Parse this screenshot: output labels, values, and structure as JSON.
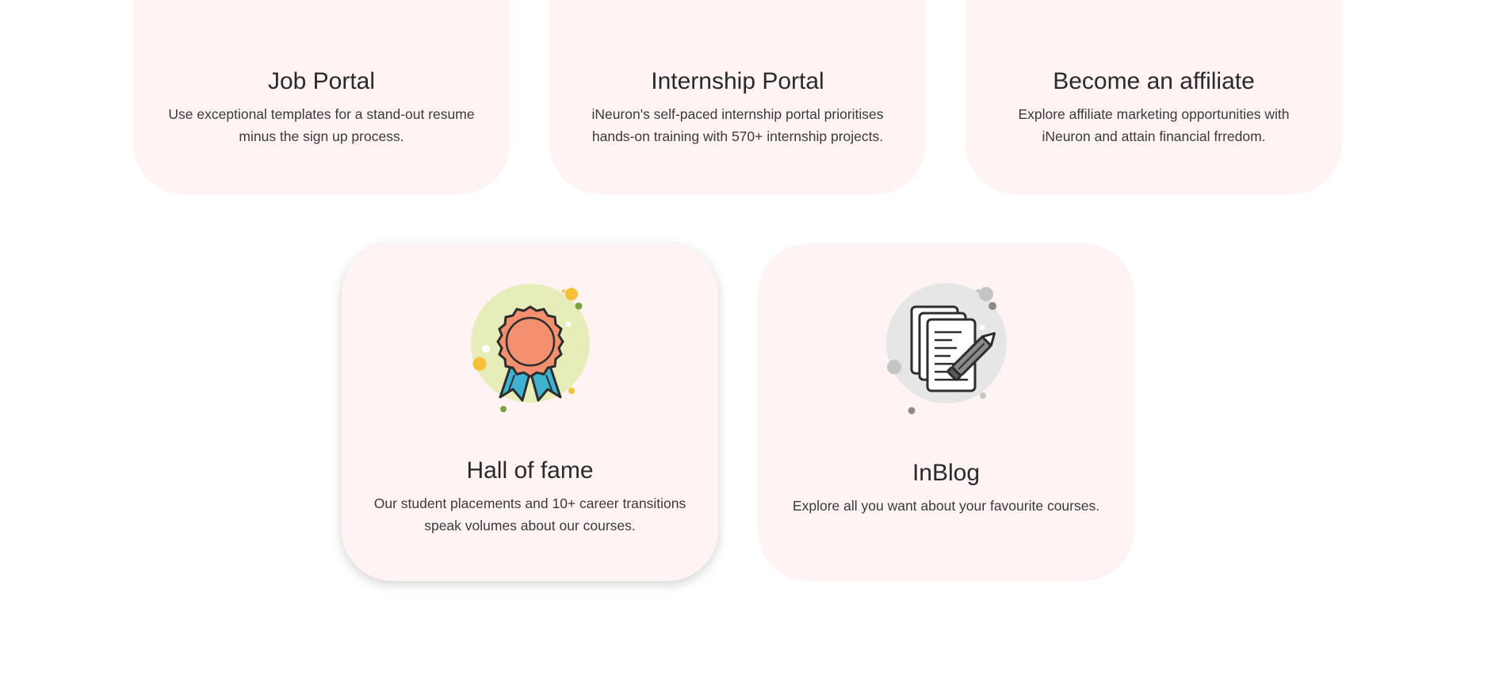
{
  "cards": {
    "job": {
      "title": "Job Portal",
      "description": "Use exceptional templates for a stand-out resume minus the sign up process."
    },
    "internship": {
      "title": "Internship Portal",
      "description": "iNeuron's self-paced internship portal prioritises hands-on training with 570+ internship projects."
    },
    "affiliate": {
      "title": "Become an affiliate",
      "description": "Explore affiliate marketing opportunities with iNeuron and attain financial frredom."
    },
    "hall_of_fame": {
      "title": "Hall of fame",
      "description": "Our student placements and 10+ career transitions speak volumes about our courses.",
      "icon": "award-ribbon-icon"
    },
    "blog": {
      "title": "InBlog",
      "description": "Explore all you want about your favourite courses.",
      "icon": "documents-pencil-icon"
    }
  },
  "colors": {
    "card_bg": "#fff4f3",
    "award_circle": "#e6edb9",
    "award_medal": "#f48f70",
    "award_ribbon": "#3fb2d1",
    "blog_circle": "#e6e6e6",
    "accent_yellow": "#f5c13a",
    "accent_green": "#7ba23f"
  }
}
